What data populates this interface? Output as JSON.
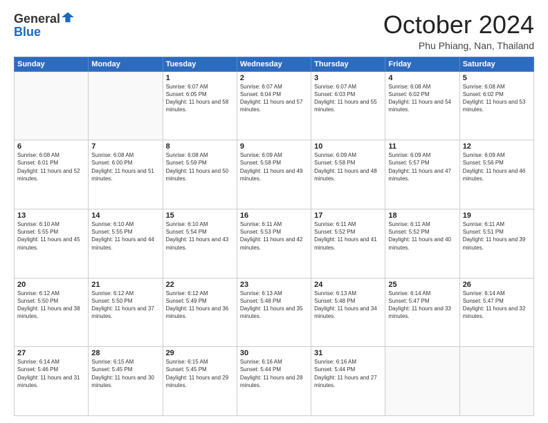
{
  "header": {
    "logo_general": "General",
    "logo_blue": "Blue",
    "month_title": "October 2024",
    "location": "Phu Phiang, Nan, Thailand"
  },
  "days_of_week": [
    "Sunday",
    "Monday",
    "Tuesday",
    "Wednesday",
    "Thursday",
    "Friday",
    "Saturday"
  ],
  "weeks": [
    [
      {
        "day": "",
        "info": ""
      },
      {
        "day": "",
        "info": ""
      },
      {
        "day": "1",
        "info": "Sunrise: 6:07 AM\nSunset: 6:05 PM\nDaylight: 11 hours and 58 minutes."
      },
      {
        "day": "2",
        "info": "Sunrise: 6:07 AM\nSunset: 6:04 PM\nDaylight: 11 hours and 57 minutes."
      },
      {
        "day": "3",
        "info": "Sunrise: 6:07 AM\nSunset: 6:03 PM\nDaylight: 11 hours and 55 minutes."
      },
      {
        "day": "4",
        "info": "Sunrise: 6:08 AM\nSunset: 6:02 PM\nDaylight: 11 hours and 54 minutes."
      },
      {
        "day": "5",
        "info": "Sunrise: 6:08 AM\nSunset: 6:02 PM\nDaylight: 11 hours and 53 minutes."
      }
    ],
    [
      {
        "day": "6",
        "info": "Sunrise: 6:08 AM\nSunset: 6:01 PM\nDaylight: 11 hours and 52 minutes."
      },
      {
        "day": "7",
        "info": "Sunrise: 6:08 AM\nSunset: 6:00 PM\nDaylight: 11 hours and 51 minutes."
      },
      {
        "day": "8",
        "info": "Sunrise: 6:08 AM\nSunset: 5:59 PM\nDaylight: 11 hours and 50 minutes."
      },
      {
        "day": "9",
        "info": "Sunrise: 6:09 AM\nSunset: 5:58 PM\nDaylight: 11 hours and 49 minutes."
      },
      {
        "day": "10",
        "info": "Sunrise: 6:09 AM\nSunset: 5:58 PM\nDaylight: 11 hours and 48 minutes."
      },
      {
        "day": "11",
        "info": "Sunrise: 6:09 AM\nSunset: 5:57 PM\nDaylight: 11 hours and 47 minutes."
      },
      {
        "day": "12",
        "info": "Sunrise: 6:09 AM\nSunset: 5:56 PM\nDaylight: 11 hours and 46 minutes."
      }
    ],
    [
      {
        "day": "13",
        "info": "Sunrise: 6:10 AM\nSunset: 5:55 PM\nDaylight: 11 hours and 45 minutes."
      },
      {
        "day": "14",
        "info": "Sunrise: 6:10 AM\nSunset: 5:55 PM\nDaylight: 11 hours and 44 minutes."
      },
      {
        "day": "15",
        "info": "Sunrise: 6:10 AM\nSunset: 5:54 PM\nDaylight: 11 hours and 43 minutes."
      },
      {
        "day": "16",
        "info": "Sunrise: 6:11 AM\nSunset: 5:53 PM\nDaylight: 11 hours and 42 minutes."
      },
      {
        "day": "17",
        "info": "Sunrise: 6:11 AM\nSunset: 5:52 PM\nDaylight: 11 hours and 41 minutes."
      },
      {
        "day": "18",
        "info": "Sunrise: 6:11 AM\nSunset: 5:52 PM\nDaylight: 11 hours and 40 minutes."
      },
      {
        "day": "19",
        "info": "Sunrise: 6:11 AM\nSunset: 5:51 PM\nDaylight: 11 hours and 39 minutes."
      }
    ],
    [
      {
        "day": "20",
        "info": "Sunrise: 6:12 AM\nSunset: 5:50 PM\nDaylight: 11 hours and 38 minutes."
      },
      {
        "day": "21",
        "info": "Sunrise: 6:12 AM\nSunset: 5:50 PM\nDaylight: 11 hours and 37 minutes."
      },
      {
        "day": "22",
        "info": "Sunrise: 6:12 AM\nSunset: 5:49 PM\nDaylight: 11 hours and 36 minutes."
      },
      {
        "day": "23",
        "info": "Sunrise: 6:13 AM\nSunset: 5:48 PM\nDaylight: 11 hours and 35 minutes."
      },
      {
        "day": "24",
        "info": "Sunrise: 6:13 AM\nSunset: 5:48 PM\nDaylight: 11 hours and 34 minutes."
      },
      {
        "day": "25",
        "info": "Sunrise: 6:14 AM\nSunset: 5:47 PM\nDaylight: 11 hours and 33 minutes."
      },
      {
        "day": "26",
        "info": "Sunrise: 6:14 AM\nSunset: 5:47 PM\nDaylight: 11 hours and 32 minutes."
      }
    ],
    [
      {
        "day": "27",
        "info": "Sunrise: 6:14 AM\nSunset: 5:46 PM\nDaylight: 11 hours and 31 minutes."
      },
      {
        "day": "28",
        "info": "Sunrise: 6:15 AM\nSunset: 5:45 PM\nDaylight: 11 hours and 30 minutes."
      },
      {
        "day": "29",
        "info": "Sunrise: 6:15 AM\nSunset: 5:45 PM\nDaylight: 11 hours and 29 minutes."
      },
      {
        "day": "30",
        "info": "Sunrise: 6:16 AM\nSunset: 5:44 PM\nDaylight: 11 hours and 28 minutes."
      },
      {
        "day": "31",
        "info": "Sunrise: 6:16 AM\nSunset: 5:44 PM\nDaylight: 11 hours and 27 minutes."
      },
      {
        "day": "",
        "info": ""
      },
      {
        "day": "",
        "info": ""
      }
    ]
  ]
}
